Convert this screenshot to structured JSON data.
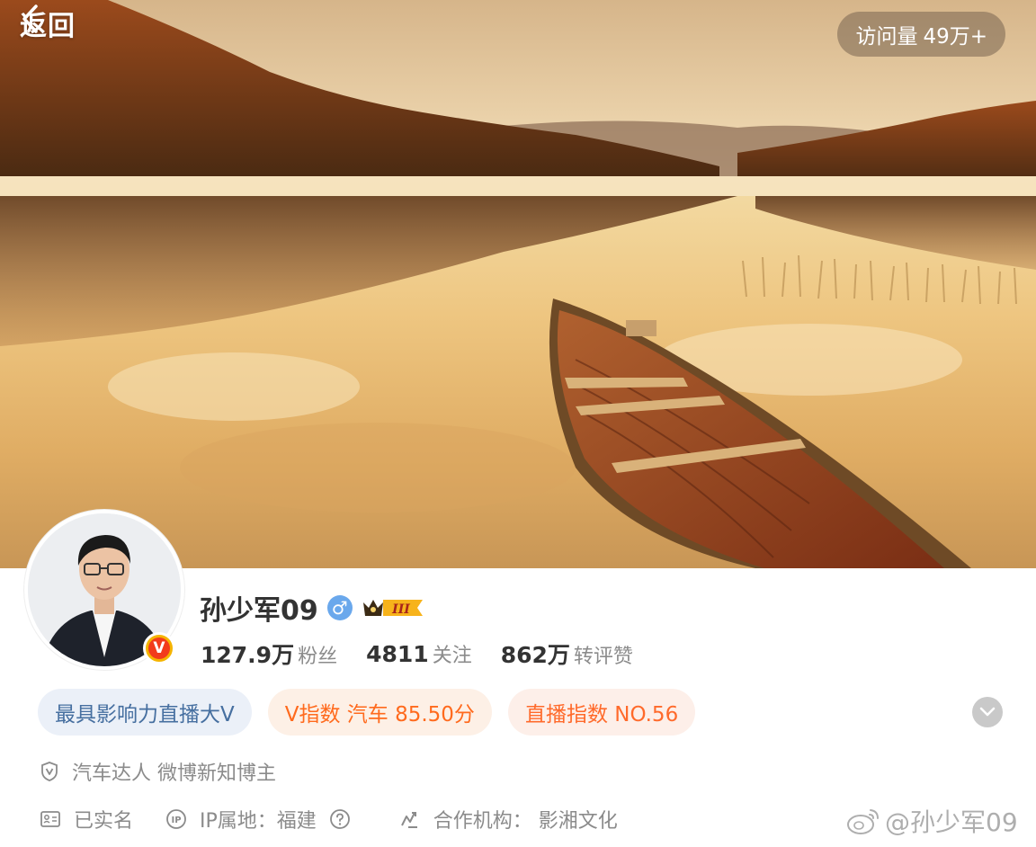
{
  "header": {
    "back_label": "返回",
    "visits_label": "访问量",
    "visits_value": "49万+"
  },
  "profile": {
    "name": "孙少军09",
    "gender_symbol": "♂",
    "level_label": "III",
    "stats": [
      {
        "value": "127.9万",
        "label": "粉丝"
      },
      {
        "value": "4811",
        "label": "关注"
      },
      {
        "value": "862万",
        "label": "转评赞"
      }
    ],
    "tags": [
      {
        "text": "最具影响力直播大V"
      },
      {
        "text": "V指数 汽车 85.50分"
      },
      {
        "text": "直播指数 NO.56"
      }
    ],
    "verify_text": "汽车达人 微博新知博主",
    "real_name_text": "已实名",
    "ip_text": "IP属地：福建",
    "agency_text": "合作机构：  影湘文化"
  },
  "watermark": {
    "text": "@孙少军09"
  },
  "colors": {
    "accent_orange": "#ff6a1d",
    "tag_blue_text": "#466fa0",
    "verified_badge": "#f23b1c",
    "gender_blue": "#6aa8ec"
  }
}
